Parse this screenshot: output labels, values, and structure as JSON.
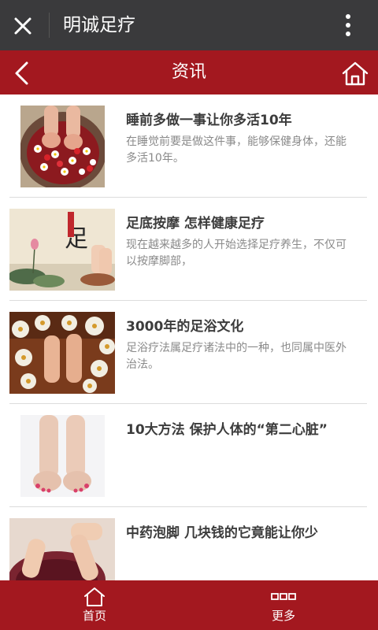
{
  "wechat_bar": {
    "title": "明诚足疗",
    "close_icon": "close-icon",
    "more_icon": "more-vertical-icon"
  },
  "header": {
    "title": "资讯",
    "back_icon": "chevron-left-icon",
    "home_icon": "home-icon"
  },
  "news": [
    {
      "title": "睡前多做一事让你多活10年",
      "desc": "在睡觉前要是做这件事，能够保健身体，还能多活10年。",
      "image": "rose-petal-foot-bath-image"
    },
    {
      "title": "足底按摩 怎样健康足疗",
      "desc": "现在越来越多的人开始选择足疗养生，不仅可以按摩脚部，",
      "image": "lotus-ink-painting-feet-image"
    },
    {
      "title": "3000年的足浴文化",
      "desc": "足浴疗法属足疗诸法中的一种，也同属中医外治法。",
      "image": "chrysanthemum-foot-bath-image"
    },
    {
      "title": "10大方法 保护人体的“第二心脏”",
      "desc": "",
      "image": "bare-feet-image"
    },
    {
      "title": "中药泡脚 几块钱的它竟能让你少",
      "desc": "",
      "image": "herbal-foot-soak-image"
    }
  ],
  "footer": {
    "tabs": [
      {
        "label": "首页",
        "icon": "home-icon"
      },
      {
        "label": "更多",
        "icon": "more-squares-icon"
      }
    ]
  },
  "colors": {
    "brand_red": "#a3181f",
    "titlebar_dark": "#3a3a3c"
  }
}
